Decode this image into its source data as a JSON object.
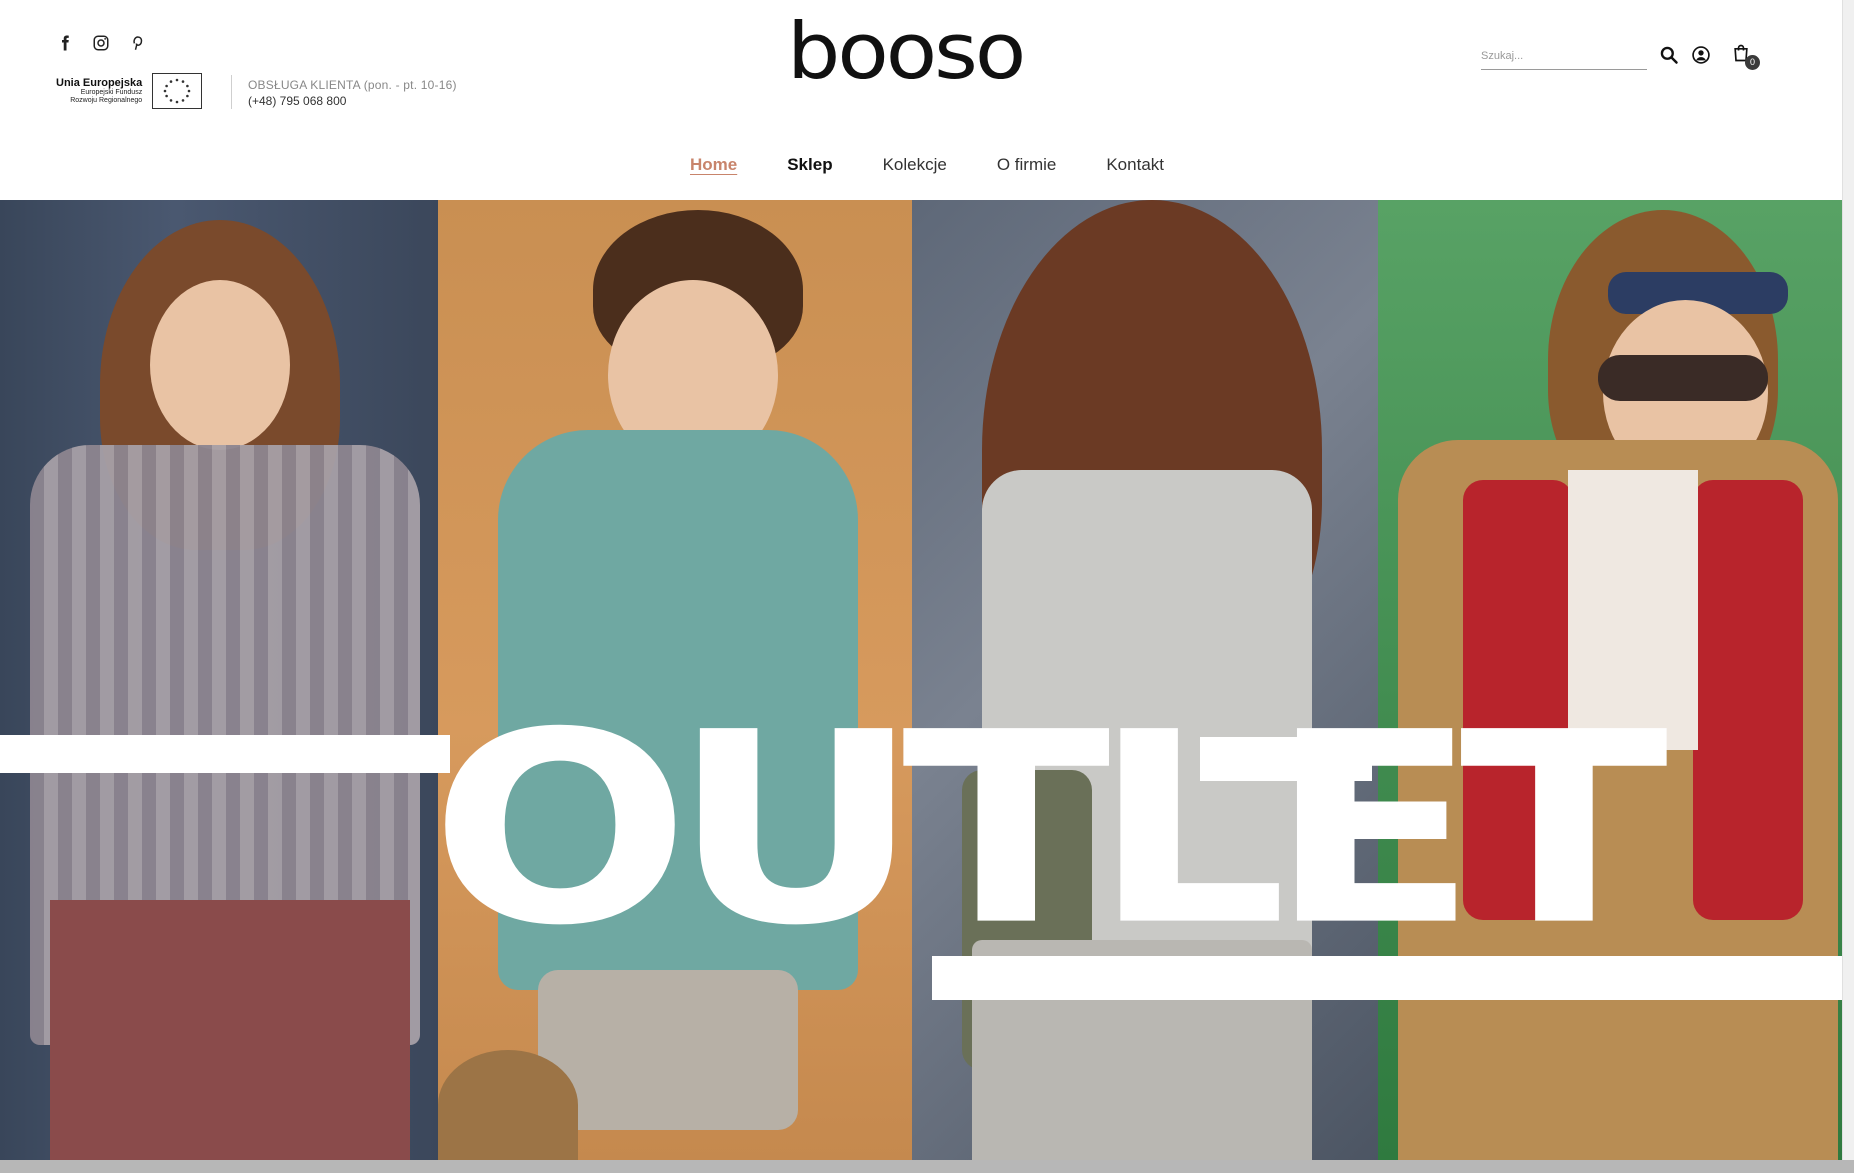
{
  "brand": {
    "logo_text": "booso"
  },
  "header": {
    "social": [
      {
        "name": "facebook-icon"
      },
      {
        "name": "instagram-icon"
      },
      {
        "name": "pinterest-icon"
      }
    ],
    "eu": {
      "title": "Unia Europejska",
      "line1": "Europejski Fundusz",
      "line2": "Rozwoju Regionalnego"
    },
    "contact": {
      "label": "OBSŁUGA KLIENTA (pon. - pt. 10-16)",
      "phone": "(+48) 795 068 800"
    },
    "search": {
      "placeholder": "Szukaj..."
    },
    "cart": {
      "count": "0"
    }
  },
  "nav": {
    "items": [
      {
        "label": "Home",
        "state": "active"
      },
      {
        "label": "Sklep",
        "state": "bold"
      },
      {
        "label": "Kolekcje",
        "state": "normal"
      },
      {
        "label": "O firmie",
        "state": "normal"
      },
      {
        "label": "Kontakt",
        "state": "normal"
      }
    ]
  },
  "hero": {
    "headline": "OUTLET"
  },
  "colors": {
    "accent": "#c8846b",
    "text": "#222222",
    "panel1": "#4a5870",
    "panel2": "#d79a5d",
    "panel3": "#7a8290",
    "panel4": "#3f8a4e"
  }
}
